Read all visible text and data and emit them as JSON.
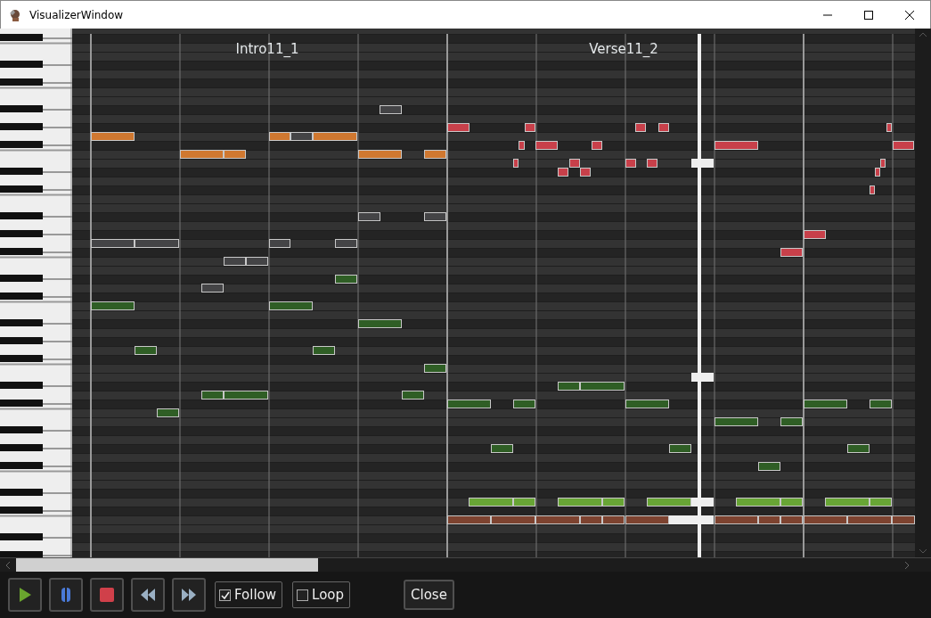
{
  "window": {
    "title": "VisualizerWindow"
  },
  "sections": [
    {
      "label": "Intro11_1"
    },
    {
      "label": "Verse11_2"
    }
  ],
  "transport": [
    {
      "kind": "play"
    },
    {
      "kind": "pause"
    },
    {
      "kind": "stop"
    },
    {
      "kind": "rewind"
    },
    {
      "kind": "forward"
    }
  ],
  "options": [
    {
      "label": "Follow",
      "checked": true
    },
    {
      "label": "Loop",
      "checked": false
    }
  ],
  "close_button": {
    "label": "Close"
  }
}
